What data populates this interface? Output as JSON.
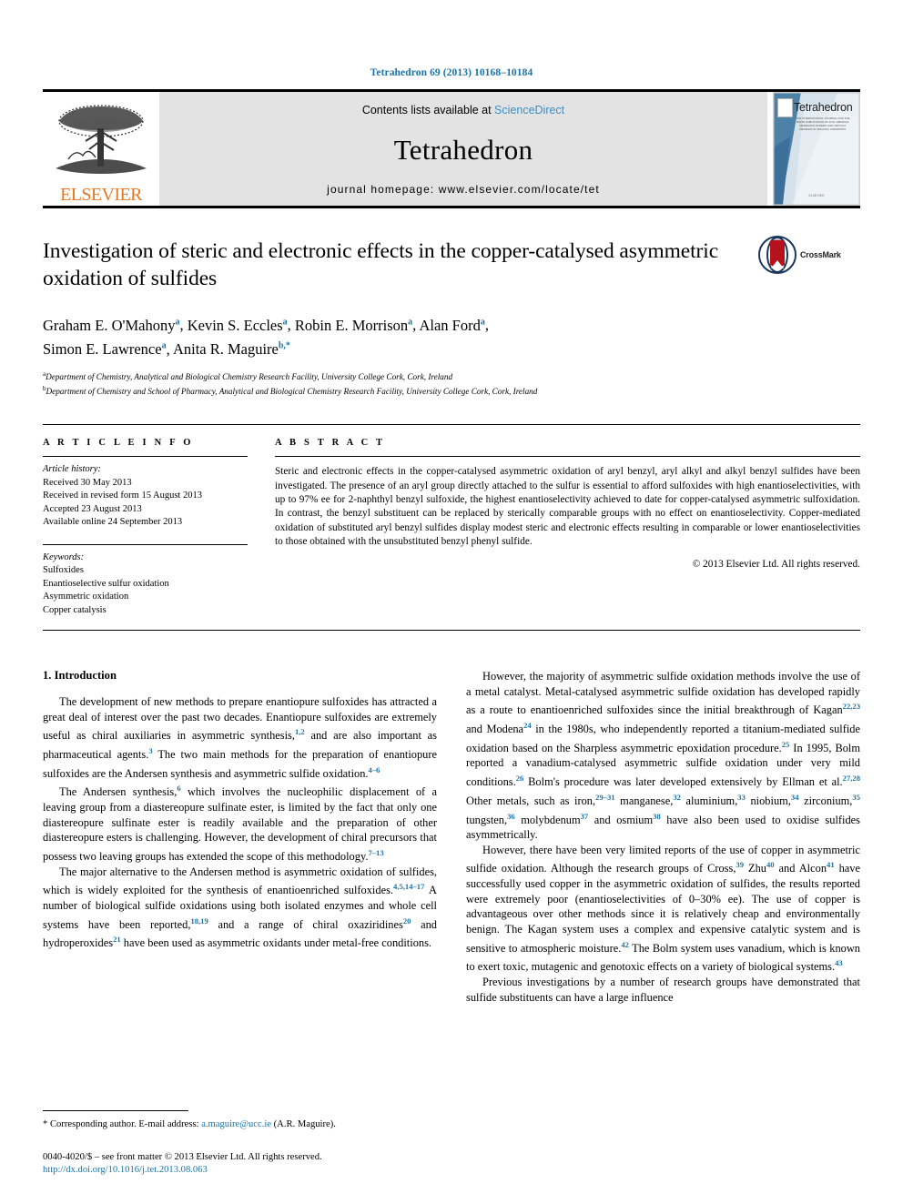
{
  "running_head": "Tetrahedron 69 (2013) 10168–10184",
  "masthead": {
    "publisher_name": "ELSEVIER",
    "contents_prefix": "Contents lists available at ",
    "sciencedirect": "ScienceDirect",
    "journal_name": "Tetrahedron",
    "homepage": "journal homepage: www.elsevier.com/locate/tet",
    "cover": {
      "title": "Tetrahedron",
      "subtitle": "THE INTERNATIONAL JOURNAL FOR THE RAPID PUBLICATION OF FULL ORIGINAL RESEARCH PAPERS AND CRITICAL REVIEWS IN ORGANIC CHEMISTRY",
      "footer": "ELSEVIER"
    }
  },
  "article": {
    "title": "Investigation of steric and electronic effects in the copper-catalysed asymmetric oxidation of sulfides",
    "crossmark_label": "CrossMark",
    "authors_line1": "Graham E. O'Mahony",
    "authors": [
      {
        "name": "Graham E. O'Mahony",
        "mark": "a"
      },
      {
        "name": "Kevin S. Eccles",
        "mark": "a"
      },
      {
        "name": "Robin E. Morrison",
        "mark": "a"
      },
      {
        "name": "Alan Ford",
        "mark": "a"
      },
      {
        "name": "Simon E. Lawrence",
        "mark": "a"
      },
      {
        "name": "Anita R. Maguire",
        "mark": "b,*"
      }
    ],
    "affiliations": [
      {
        "mark": "a",
        "text": "Department of Chemistry, Analytical and Biological Chemistry Research Facility, University College Cork, Cork, Ireland"
      },
      {
        "mark": "b",
        "text": "Department of Chemistry and School of Pharmacy, Analytical and Biological Chemistry Research Facility, University College Cork, Cork, Ireland"
      }
    ]
  },
  "article_info": {
    "heading": "A R T I C L E  I N F O",
    "history_label": "Article history:",
    "history": [
      "Received 30 May 2013",
      "Received in revised form 15 August 2013",
      "Accepted 23 August 2013",
      "Available online 24 September 2013"
    ],
    "keywords_label": "Keywords:",
    "keywords": [
      "Sulfoxides",
      "Enantioselective sulfur oxidation",
      "Asymmetric oxidation",
      "Copper catalysis"
    ]
  },
  "abstract": {
    "heading": "A B S T R A C T",
    "text": "Steric and electronic effects in the copper-catalysed asymmetric oxidation of aryl benzyl, aryl alkyl and alkyl benzyl sulfides have been investigated. The presence of an aryl group directly attached to the sulfur is essential to afford sulfoxides with high enantioselectivities, with up to 97% ee for 2-naphthyl benzyl sulfoxide, the highest enantioselectivity achieved to date for copper-catalysed asymmetric sulfoxidation. In contrast, the benzyl substituent can be replaced by sterically comparable groups with no effect on enantioselectivity. Copper-mediated oxidation of substituted aryl benzyl sulfides display modest steric and electronic effects resulting in comparable or lower enantioselectivities to those obtained with the unsubstituted benzyl phenyl sulfide.",
    "copyright": "© 2013 Elsevier Ltd. All rights reserved."
  },
  "body": {
    "section_heading": "1. Introduction",
    "left_paragraphs": [
      {
        "parts": [
          {
            "t": "The development of new methods to prepare enantiopure sulfoxides has attracted a great deal of interest over the past two decades. Enantiopure sulfoxides are extremely useful as chiral auxiliaries in asymmetric synthesis,"
          },
          {
            "sup": "1,2"
          },
          {
            "t": " and are also important as pharmaceutical agents."
          },
          {
            "sup": "3"
          },
          {
            "t": " The two main methods for the preparation of enantiopure sulfoxides are the Andersen synthesis and asymmetric sulfide oxidation."
          },
          {
            "sup": "4–6"
          }
        ]
      },
      {
        "parts": [
          {
            "t": "The Andersen synthesis,"
          },
          {
            "sup": "6"
          },
          {
            "t": " which involves the nucleophilic displacement of a leaving group from a diastereopure sulfinate ester, is limited by the fact that only one diastereopure sulfinate ester is readily available and the preparation of other diastereopure esters is challenging. However, the development of chiral precursors that possess two leaving groups has extended the scope of this methodology."
          },
          {
            "sup": "7–13"
          }
        ]
      },
      {
        "parts": [
          {
            "t": "The major alternative to the Andersen method is asymmetric oxidation of sulfides, which is widely exploited for the synthesis of enantioenriched sulfoxides."
          },
          {
            "sup": "4,5,14–17"
          },
          {
            "t": " A number of biological sulfide oxidations using both isolated enzymes and whole cell systems have been reported,"
          },
          {
            "sup": "18,19"
          },
          {
            "t": " and a range of chiral oxaziridines"
          },
          {
            "sup": "20"
          },
          {
            "t": " and hydroperoxides"
          },
          {
            "sup": "21"
          },
          {
            "t": " have been used as asymmetric oxidants under metal-free conditions."
          }
        ]
      }
    ],
    "right_paragraphs": [
      {
        "parts": [
          {
            "t": "However, the majority of asymmetric sulfide oxidation methods involve the use of a metal catalyst. Metal-catalysed asymmetric sulfide oxidation has developed rapidly as a route to enantioenriched sulfoxides since the initial breakthrough of Kagan"
          },
          {
            "sup": "22,23"
          },
          {
            "t": " and Modena"
          },
          {
            "sup": "24"
          },
          {
            "t": " in the 1980s, who independently reported a titanium-mediated sulfide oxidation based on the Sharpless asymmetric epoxidation procedure."
          },
          {
            "sup": "25"
          },
          {
            "t": " In 1995, Bolm reported a vanadium-catalysed asymmetric sulfide oxidation under very mild conditions."
          },
          {
            "sup": "26"
          },
          {
            "t": " Bolm's procedure was later developed extensively by Ellman et al."
          },
          {
            "sup": "27,28"
          },
          {
            "t": " Other metals, such as iron,"
          },
          {
            "sup": "29–31"
          },
          {
            "t": " manganese,"
          },
          {
            "sup": "32"
          },
          {
            "t": " aluminium,"
          },
          {
            "sup": "33"
          },
          {
            "t": " niobium,"
          },
          {
            "sup": "34"
          },
          {
            "t": " zirconium,"
          },
          {
            "sup": "35"
          },
          {
            "t": " tungsten,"
          },
          {
            "sup": "36"
          },
          {
            "t": " molybdenum"
          },
          {
            "sup": "37"
          },
          {
            "t": " and osmium"
          },
          {
            "sup": "38"
          },
          {
            "t": " have also been used to oxidise sulfides asymmetrically."
          }
        ]
      },
      {
        "parts": [
          {
            "t": "However, there have been very limited reports of the use of copper in asymmetric sulfide oxidation. Although the research groups of Cross,"
          },
          {
            "sup": "39"
          },
          {
            "t": " Zhu"
          },
          {
            "sup": "40"
          },
          {
            "t": " and Alcon"
          },
          {
            "sup": "41"
          },
          {
            "t": " have successfully used copper in the asymmetric oxidation of sulfides, the results reported were extremely poor (enantioselectivities of 0–30% ee). The use of copper is advantageous over other methods since it is relatively cheap and environmentally benign. The Kagan system uses a complex and expensive catalytic system and is sensitive to atmospheric moisture."
          },
          {
            "sup": "42"
          },
          {
            "t": " The Bolm system uses vanadium, which is known to exert toxic, mutagenic and genotoxic effects on a variety of biological systems."
          },
          {
            "sup": "43"
          }
        ]
      },
      {
        "parts": [
          {
            "t": "Previous investigations by a number of research groups have demonstrated that sulfide substituents can have a large influence"
          }
        ]
      }
    ]
  },
  "footer": {
    "corresponding_prefix": "* Corresponding author. E-mail address: ",
    "corresponding_email": "a.maguire@ucc.ie",
    "corresponding_suffix": " (A.R. Maguire).",
    "issn_line": "0040-4020/$ – see front matter © 2013 Elsevier Ltd. All rights reserved.",
    "doi_line": "http://dx.doi.org/10.1016/j.tet.2013.08.063"
  },
  "colors": {
    "link": "#1a74a8",
    "elsevier_orange": "#e87722",
    "masthead_gray": "#e3e3e3",
    "sciencedirect_blue": "#3a8fc4"
  }
}
